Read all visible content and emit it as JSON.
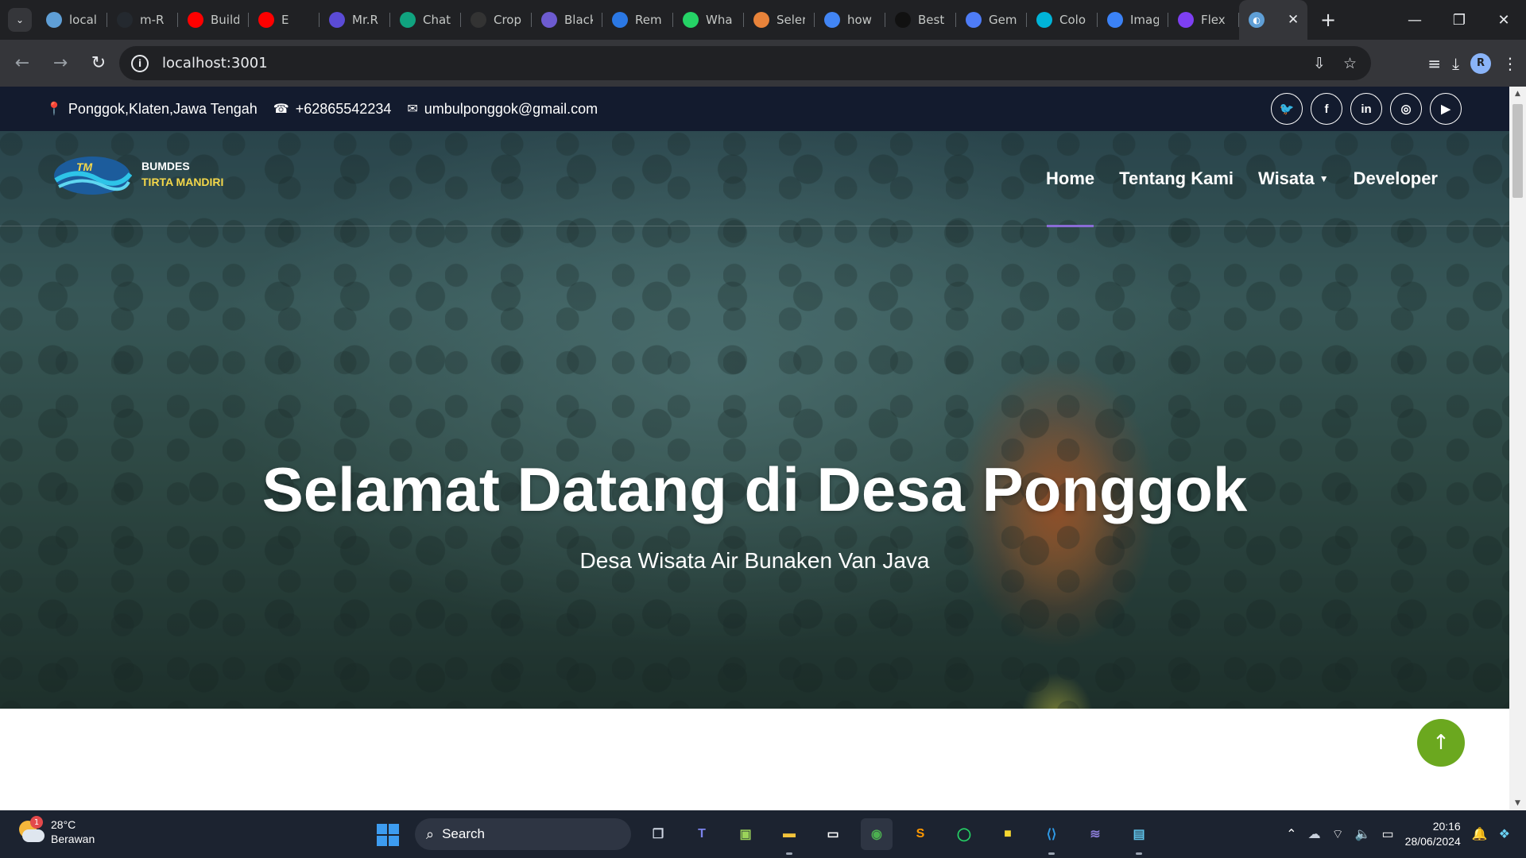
{
  "browser": {
    "tabs": [
      {
        "title": "local",
        "fav_color": "#5f9fd6",
        "icon": "site-globe-icon"
      },
      {
        "title": "m-R",
        "fav_color": "#24292f",
        "icon": "github-icon"
      },
      {
        "title": "Build",
        "fav_color": "#ff0000",
        "icon": "youtube-icon"
      },
      {
        "title": "E",
        "fav_color": "#ff0000",
        "icon": "youtube-icon"
      },
      {
        "title": "Mr.R",
        "fav_color": "#5b4bd6",
        "icon": "vercel-icon"
      },
      {
        "title": "Chat",
        "fav_color": "#10a37f",
        "icon": "chatgpt-icon"
      },
      {
        "title": "Crop",
        "fav_color": "#333333",
        "icon": "io-icon"
      },
      {
        "title": "Black",
        "fav_color": "#6d5bd0",
        "icon": "blackbox-icon"
      },
      {
        "title": "Rem",
        "fav_color": "#2b78e4",
        "icon": "bookmark-icon"
      },
      {
        "title": "Wha",
        "fav_color": "#25d366",
        "icon": "whatsapp-icon"
      },
      {
        "title": "Seler",
        "fav_color": "#e8833a",
        "icon": "selenium-icon"
      },
      {
        "title": "how",
        "fav_color": "#4285f4",
        "icon": "google-icon"
      },
      {
        "title": "Best",
        "fav_color": "#111111",
        "icon": "arrow-icon"
      },
      {
        "title": "Gem",
        "fav_color": "#4e7cf6",
        "icon": "gemini-icon"
      },
      {
        "title": "Colo",
        "fav_color": "#00b4d8",
        "icon": "canva-icon"
      },
      {
        "title": "Imag",
        "fav_color": "#3b82f6",
        "icon": "image-icon"
      },
      {
        "title": "Flex",
        "fav_color": "#7e3ff2",
        "icon": "bootstrap-icon"
      }
    ],
    "active_tab": {
      "title": "",
      "fav_color": "#5f9fd6",
      "icon": "site-globe-icon"
    },
    "url": "localhost:3001"
  },
  "topbar": {
    "address": "Ponggok,Klaten,Jawa Tengah",
    "phone": "+62865542234",
    "email": "umbulponggok@gmail.com",
    "socials": [
      "twitter",
      "facebook",
      "linkedin",
      "instagram",
      "youtube"
    ]
  },
  "navbar": {
    "logo_line1": "BUMDES",
    "logo_line2": "TIRTA MANDIRI",
    "logo_mark_text": "TM",
    "menu": {
      "home": "Home",
      "about": "Tentang Kami",
      "wisata": "Wisata",
      "developer": "Developer"
    },
    "active_item": "Home"
  },
  "hero": {
    "title": "Selamat Datang di Desa Ponggok",
    "subtitle": "Desa Wisata Air Bunaken Van Java"
  },
  "taskbar": {
    "weather_temp": "28°C",
    "weather_desc": "Berawan",
    "weather_badge": "1",
    "search_label": "Search",
    "time": "20:16",
    "date": "28/06/2024"
  },
  "colors": {
    "topbar_bg": "#131b2e",
    "nav_active_underline": "#8a6cd6",
    "back_to_top": "#6ba81f",
    "logo_accent": "#f5d84a"
  }
}
